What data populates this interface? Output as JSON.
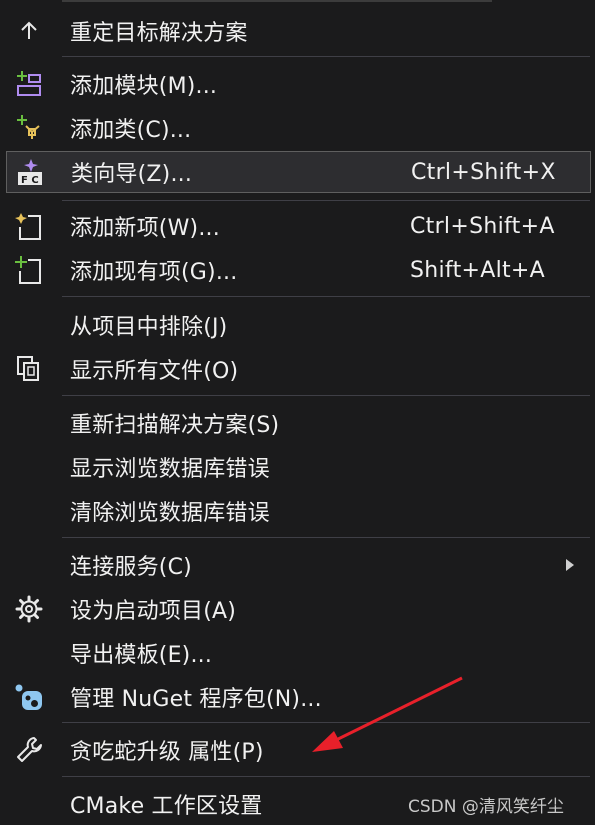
{
  "menu": {
    "items": [
      {
        "label": "重定目标解决方案",
        "shortcut": "",
        "icon": "arrow-up-icon"
      },
      {
        "label": "添加模块(M)...",
        "shortcut": "",
        "icon": "add-module-icon"
      },
      {
        "label": "添加类(C)...",
        "shortcut": "",
        "icon": "add-class-icon"
      },
      {
        "label": "类向导(Z)...",
        "shortcut": "Ctrl+Shift+X",
        "icon": "class-wizard-icon"
      },
      {
        "label": "添加新项(W)...",
        "shortcut": "Ctrl+Shift+A",
        "icon": "add-new-item-icon"
      },
      {
        "label": "添加现有项(G)...",
        "shortcut": "Shift+Alt+A",
        "icon": "add-existing-item-icon"
      },
      {
        "label": "从项目中排除(J)",
        "shortcut": "",
        "icon": ""
      },
      {
        "label": "显示所有文件(O)",
        "shortcut": "",
        "icon": "show-all-files-icon"
      },
      {
        "label": "重新扫描解决方案(S)",
        "shortcut": "",
        "icon": ""
      },
      {
        "label": "显示浏览数据库错误",
        "shortcut": "",
        "icon": ""
      },
      {
        "label": "清除浏览数据库错误",
        "shortcut": "",
        "icon": ""
      },
      {
        "label": "连接服务(C)",
        "shortcut": "",
        "icon": ""
      },
      {
        "label": "设为启动项目(A)",
        "shortcut": "",
        "icon": "gear-icon"
      },
      {
        "label": "导出模板(E)...",
        "shortcut": "",
        "icon": ""
      },
      {
        "label": "管理 NuGet 程序包(N)...",
        "shortcut": "",
        "icon": "nuget-icon"
      },
      {
        "label": "贪吃蛇升级 属性(P)",
        "shortcut": "",
        "icon": "wrench-icon"
      },
      {
        "label": "CMake 工作区设置",
        "shortcut": "",
        "icon": ""
      }
    ],
    "selected_label": "类向导(Z)..."
  },
  "watermark": "CSDN @清风笑纤尘",
  "colors": {
    "background": "#1b1b1c",
    "separator": "#3f3f46",
    "selected_border": "#5f5f5f",
    "text": "#f1f1f1",
    "annotation_arrow": "#e8202a",
    "icon_green": "#6abf40",
    "icon_yellow": "#e6c15a",
    "icon_blue": "#8fc7f0",
    "icon_purple": "#b08cf0"
  }
}
